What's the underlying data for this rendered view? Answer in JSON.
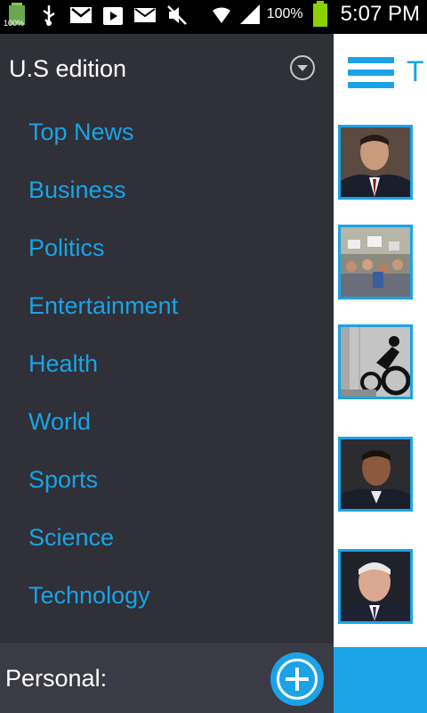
{
  "status_bar": {
    "battery_small_label": "100%",
    "battery_percent": "100%",
    "time": "5:07 PM"
  },
  "drawer": {
    "edition_label": "U.S edition",
    "nav_items": [
      {
        "label": "Top News"
      },
      {
        "label": "Business"
      },
      {
        "label": "Politics"
      },
      {
        "label": "Entertainment"
      },
      {
        "label": "Health"
      },
      {
        "label": "World"
      },
      {
        "label": "Sports"
      },
      {
        "label": "Science"
      },
      {
        "label": "Technology"
      }
    ],
    "personal_label": "Personal:"
  },
  "main": {
    "title_peek": "T"
  },
  "colors": {
    "accent": "#1aa3e6",
    "drawer_bg": "#2f3038",
    "personal_bg": "#3a3b44"
  }
}
